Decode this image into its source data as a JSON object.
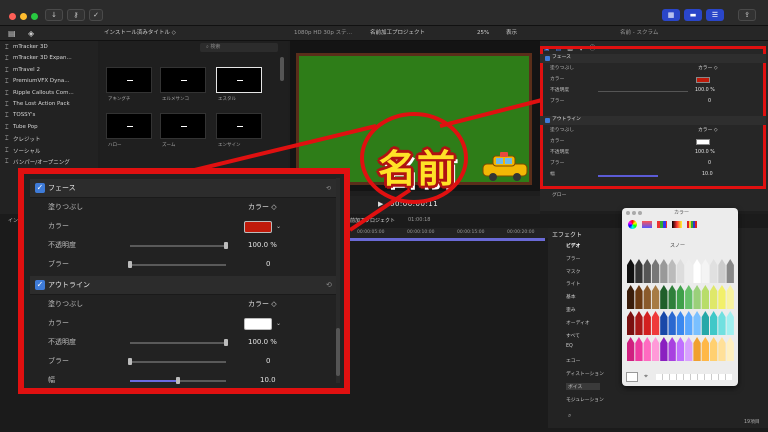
{
  "window": {
    "toolbar_icons": [
      "download-icon",
      "key-icon",
      "check-icon",
      "share-icon"
    ]
  },
  "browser": {
    "header": "インストール済みタイトル ◇",
    "search_placeholder": "検索",
    "sidebar": [
      {
        "label": "mTracker 3D"
      },
      {
        "label": "mTracker 3D Expan..."
      },
      {
        "label": "mTravel 2"
      },
      {
        "label": "PremiumVFX Dyna..."
      },
      {
        "label": "Ripple Callouts Com..."
      },
      {
        "label": "The Lost Action Pack"
      },
      {
        "label": "TOSSY's"
      },
      {
        "label": "Tube Pop"
      },
      {
        "label": "クレジット"
      },
      {
        "label": "ソーシャル"
      },
      {
        "label": "バンパー/オープニング"
      }
    ],
    "thumbs_row1": [
      "アキングチ",
      "エルメサンコ",
      "エスタル"
    ],
    "thumbs_row2": [
      "ハロー",
      "ズーム",
      "エンサイン"
    ]
  },
  "viewer": {
    "format": "1080p HD 30p ステ…",
    "project": "名前加工プロジェクト",
    "zoom": "25%",
    "view": "表示",
    "timecode": "00:00:00:11",
    "overlay_text": "名前",
    "accent": "#e01010"
  },
  "inspector": {
    "tab_title": "名前 - スクラム",
    "face_title": "フェース",
    "outline_title": "アウトライン",
    "glow_title": "グロー",
    "fill_label": "塗りつぶし",
    "color_label": "カラー",
    "opacity_label": "不透明度",
    "blur_label": "ブラー",
    "width_label": "幅",
    "fill_value": "カラー ◇",
    "face_opacity": "100.0 %",
    "face_blur": "0",
    "outline_opacity": "100.0 %",
    "outline_blur": "0",
    "outline_width": "10.0"
  },
  "timeline": {
    "label_index": "インデックス",
    "project": "名前加工プロジェクト",
    "duration": "01:00:18",
    "ticks": [
      "00:00:05:00",
      "00:00:10:00",
      "00:00:15:00",
      "00:00:20:00"
    ]
  },
  "effects": {
    "title": "エフェクト",
    "categories": [
      "ビデオ",
      "ブラー",
      "マスク",
      "ライト",
      "基本",
      "歪み",
      "オーディオ",
      "すべて",
      "EQ",
      "エコー",
      "ディストーション",
      "ボイス",
      "モジュレーション"
    ],
    "count": "19項目"
  },
  "picker": {
    "title": "カラー",
    "swatch_name": "スノー"
  },
  "zoom": {
    "face_title": "フェース",
    "outline_title": "アウトライン",
    "fill_label": "塗りつぶし",
    "fill_value": "カラー ◇",
    "color_label": "カラー",
    "opacity_label": "不透明度",
    "blur_label": "ブラー",
    "width_label": "幅",
    "face_color": "#c01a0a",
    "outline_color": "#ffffff",
    "face_opacity": "100.0 %",
    "face_blur": "0",
    "outline_opacity": "100.0 %",
    "outline_blur": "0",
    "outline_width": "10.0",
    "face_opacity_level": 1.0,
    "outline_opacity_level": 1.0,
    "outline_width_level": 0.5
  }
}
